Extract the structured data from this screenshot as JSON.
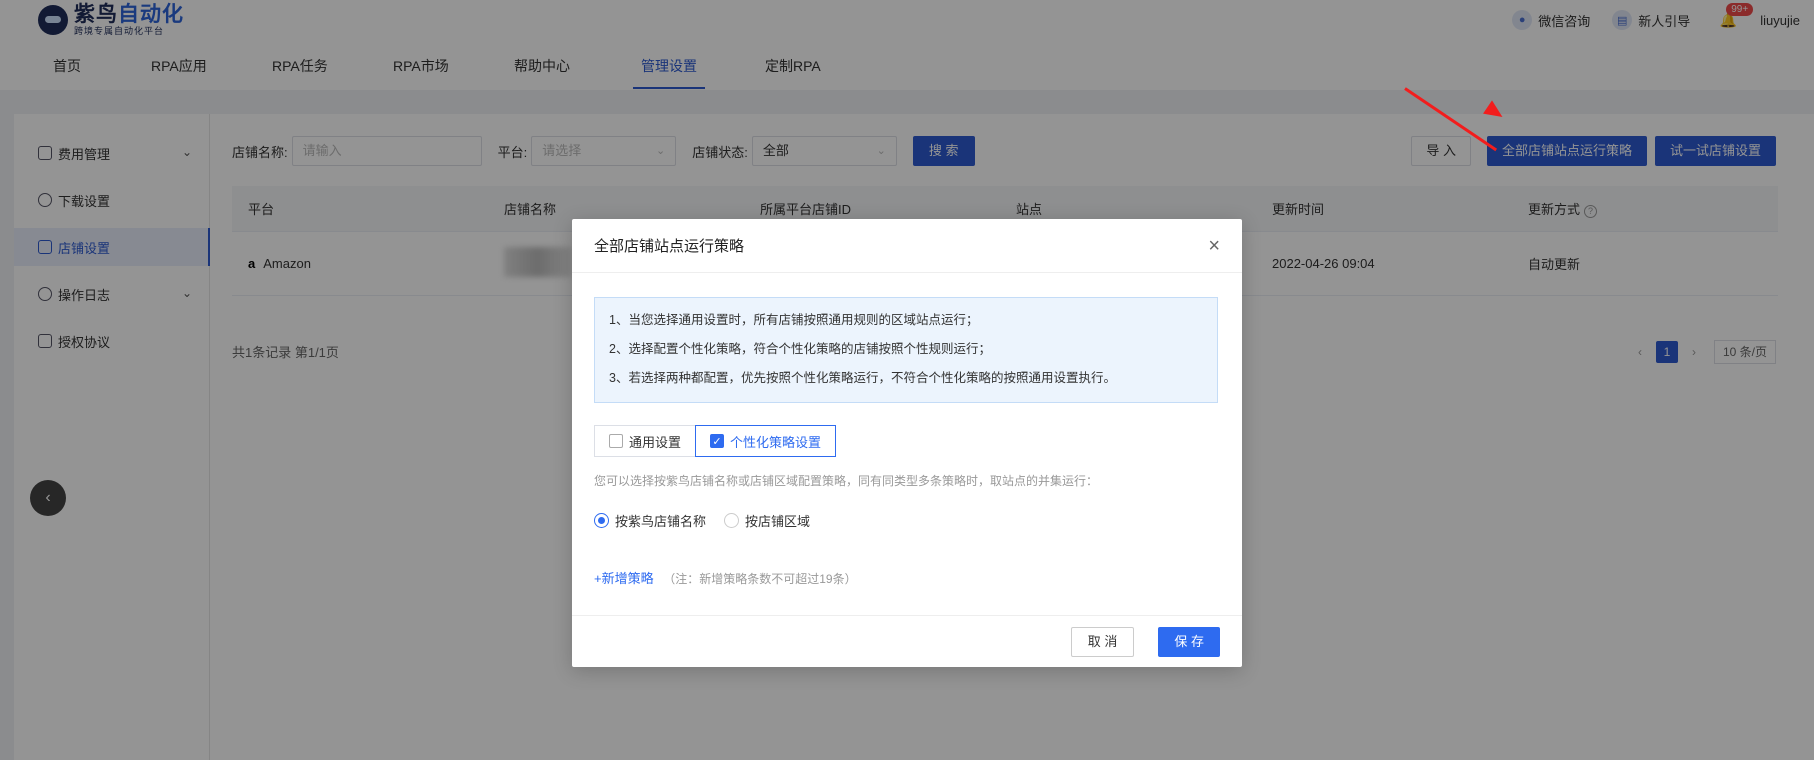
{
  "brand": {
    "title_prefix": "紫鸟",
    "title_highlight": "自动化",
    "subtitle": "跨境专属自动化平台"
  },
  "topbar": {
    "wechat": "微信咨询",
    "guide": "新人引导",
    "badge": "99+",
    "username": "liuyujie"
  },
  "nav": [
    "首页",
    "RPA应用",
    "RPA任务",
    "RPA市场",
    "帮助中心",
    "管理设置",
    "定制RPA"
  ],
  "nav_active": "管理设置",
  "sidebar": [
    {
      "label": "费用管理",
      "has_chevron": true
    },
    {
      "label": "下载设置",
      "has_chevron": false
    },
    {
      "label": "店铺设置",
      "has_chevron": false,
      "active": true
    },
    {
      "label": "操作日志",
      "has_chevron": true
    },
    {
      "label": "授权协议",
      "has_chevron": false
    }
  ],
  "filters": {
    "shop_name_label": "店铺名称:",
    "shop_name_placeholder": "请输入",
    "platform_label": "平台:",
    "platform_placeholder": "请选择",
    "status_label": "店铺状态:",
    "status_value": "全部",
    "search_btn": "搜 索"
  },
  "actions": {
    "import": "导 入",
    "all_strategy": "全部店铺站点运行策略",
    "try_settings": "试一试店铺设置"
  },
  "table": {
    "headers": [
      "平台",
      "店铺名称",
      "所属平台店铺ID",
      "站点",
      "更新时间",
      "更新方式"
    ],
    "rows": [
      {
        "platform": "Amazon",
        "platform_logo": "a",
        "update_time": "2022-04-26 09:04",
        "update_mode": "自动更新"
      }
    ]
  },
  "footer": {
    "count": "共1条记录 第1/1页",
    "page": "1",
    "page_size": "10 条/页"
  },
  "modal": {
    "title": "全部店铺站点运行策略",
    "tips": [
      "1、当您选择通用设置时，所有店铺按照通用规则的区域站点运行；",
      "2、选择配置个性化策略，符合个性化策略的店铺按照个性规则运行；",
      "3、若选择两种都配置，优先按照个性化策略运行，不符合个性化策略的按照通用设置执行。"
    ],
    "tab_general": "通用设置",
    "tab_custom": "个性化策略设置",
    "tab_general_checked": false,
    "tab_custom_checked": true,
    "hint": "您可以选择按紫鸟店铺名称或店铺区域配置策略，同有同类型多条策略时，取站点的并集运行：",
    "radio_shop_name": "按紫鸟店铺名称",
    "radio_region": "按店铺区域",
    "selected_radio": "按紫鸟店铺名称",
    "add_link": "+新增策略",
    "add_note": "（注：新增策略条数不可超过19条）",
    "cancel": "取 消",
    "save": "保 存"
  },
  "colors": {
    "primary": "#2e5bd0",
    "accent": "#2e6bf0",
    "annotation_arrow": "#f21d1d"
  }
}
